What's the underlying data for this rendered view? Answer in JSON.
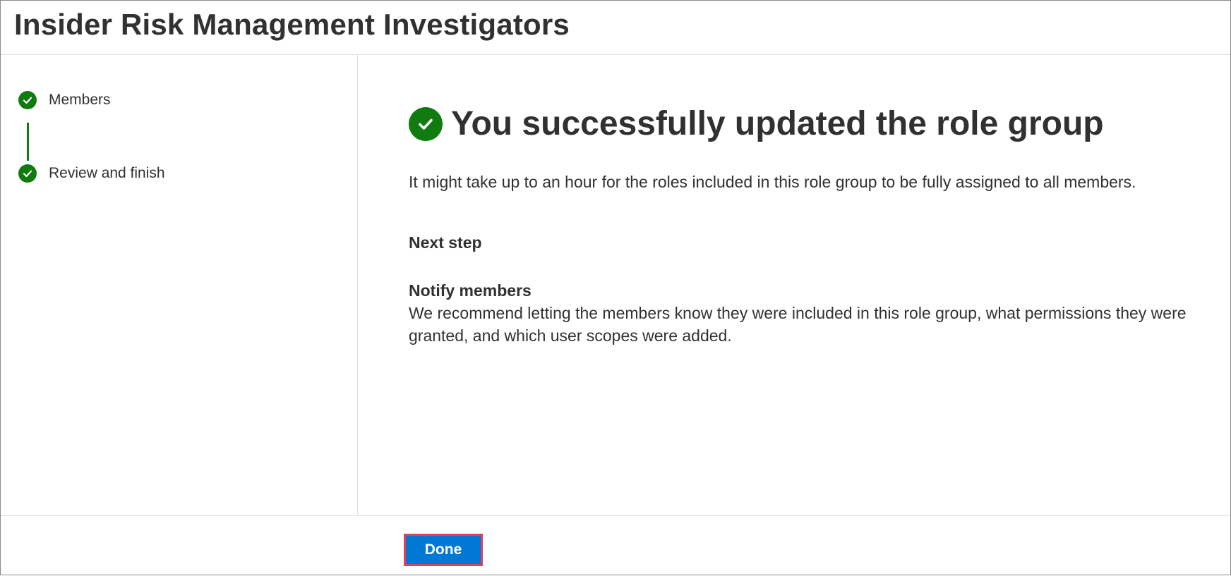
{
  "header": {
    "title": "Insider Risk Management Investigators"
  },
  "steps": [
    {
      "label": "Members",
      "status": "complete"
    },
    {
      "label": "Review and finish",
      "status": "complete"
    }
  ],
  "main": {
    "success_title": "You successfully updated the role group",
    "description": "It might take up to an hour for the roles included in this role group to be fully assigned to all members.",
    "next_step_heading": "Next step",
    "notify_heading": "Notify members",
    "notify_text": "We recommend letting the members know they were included in this role group, what permissions they were granted, and which user scopes were added."
  },
  "footer": {
    "done_label": "Done"
  },
  "colors": {
    "success_green": "#107c10",
    "primary_blue": "#0078d4",
    "highlight_border": "#e0405a",
    "text": "#323130"
  },
  "icons": {
    "step_complete": "checkmark-circle-icon",
    "success": "checkmark-circle-icon"
  }
}
